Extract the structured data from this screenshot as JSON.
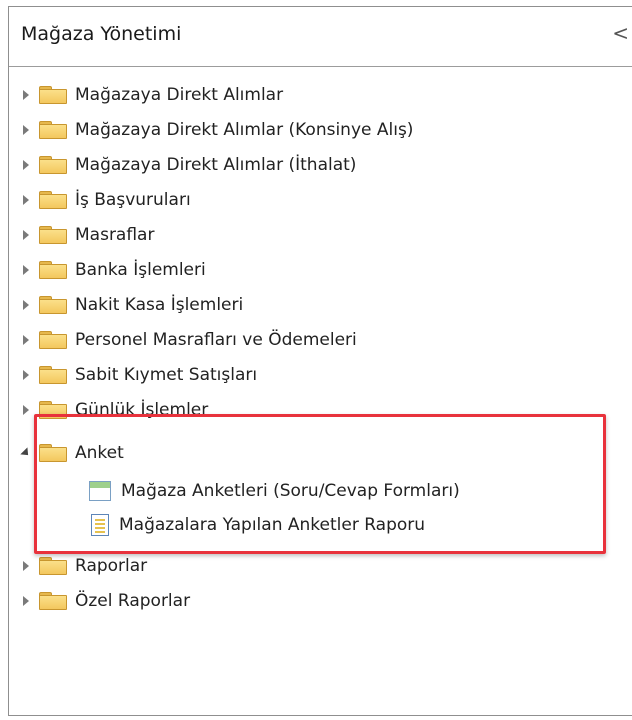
{
  "panel": {
    "title": "Mağaza Yönetimi",
    "collapse_glyph": "<"
  },
  "tree": {
    "items": [
      {
        "label": "Mağazaya Direkt Alımlar",
        "type": "folder",
        "expanded": false
      },
      {
        "label": "Mağazaya Direkt Alımlar (Konsinye Alış)",
        "type": "folder",
        "expanded": false
      },
      {
        "label": "Mağazaya Direkt Alımlar (İthalat)",
        "type": "folder",
        "expanded": false
      },
      {
        "label": "İş Başvuruları",
        "type": "folder",
        "expanded": false
      },
      {
        "label": "Masraflar",
        "type": "folder",
        "expanded": false
      },
      {
        "label": "Banka İşlemleri",
        "type": "folder",
        "expanded": false
      },
      {
        "label": "Nakit Kasa İşlemleri",
        "type": "folder",
        "expanded": false
      },
      {
        "label": "Personel Masrafları ve Ödemeleri",
        "type": "folder",
        "expanded": false
      },
      {
        "label": "Sabit Kıymet Satışları",
        "type": "folder",
        "expanded": false
      },
      {
        "label": "Günlük İşlemler",
        "type": "folder",
        "expanded": false
      },
      {
        "label": "Anket",
        "type": "folder",
        "expanded": true
      },
      {
        "label": "Mağaza Anketleri (Soru/Cevap Formları)",
        "type": "form"
      },
      {
        "label": "Mağazalara Yapılan  Anketler Raporu",
        "type": "report"
      },
      {
        "label": "Raporlar",
        "type": "folder",
        "expanded": false
      },
      {
        "label": "Özel Raporlar",
        "type": "folder",
        "expanded": false
      }
    ]
  },
  "colors": {
    "highlight_border": "#e8323c",
    "folder_fill": "#f3c75e"
  }
}
